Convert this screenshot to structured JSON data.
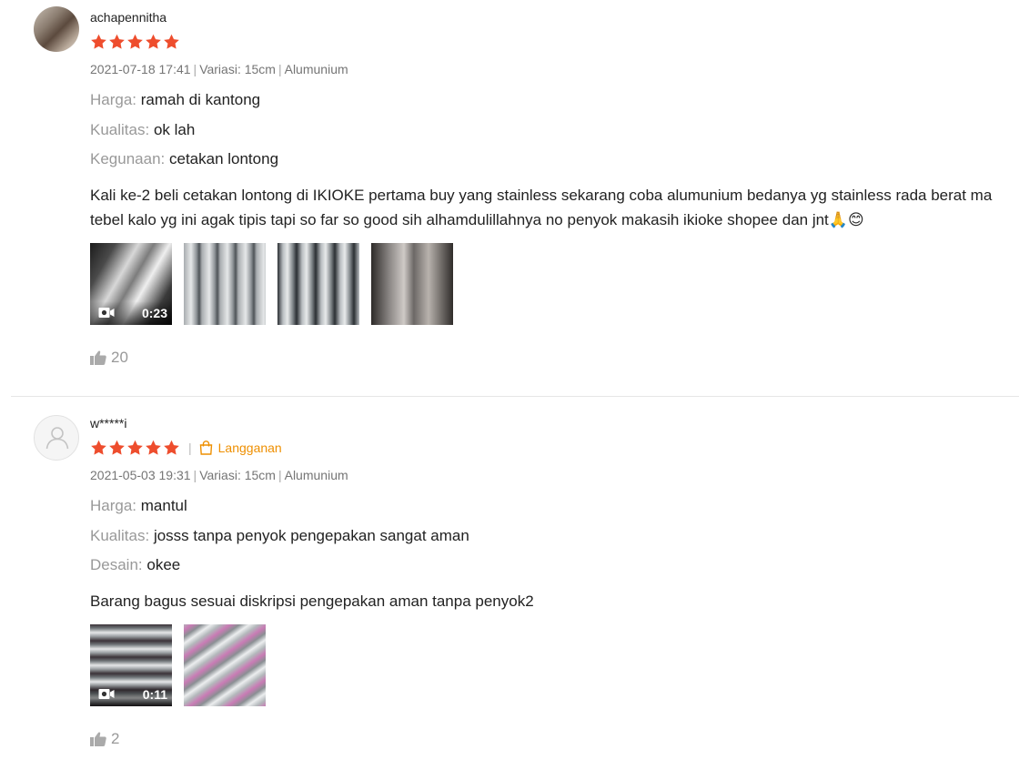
{
  "reviews": [
    {
      "username": "achapennitha",
      "rating": 5,
      "subscription": null,
      "date": "2021-07-18 17:41",
      "variation": "Variasi: 15cm",
      "material": "Alumunium",
      "attributes": [
        {
          "key": "Harga:",
          "value": "ramah di kantong"
        },
        {
          "key": "Kualitas:",
          "value": "ok lah"
        },
        {
          "key": "Kegunaan:",
          "value": "cetakan lontong"
        }
      ],
      "comment": "Kali ke-2 beli cetakan lontong di IKIOKE pertama buy yang stainless sekarang coba alumunium bedanya yg stainless rada berat ma tebel kalo yg ini agak tipis tapi so far so good sih alhamdulillahnya no penyok makasih ikioke shopee dan jnt🙏😊",
      "video_duration": "0:23",
      "likes": "20"
    },
    {
      "username": "w*****i",
      "rating": 5,
      "subscription": "Langganan",
      "date": "2021-05-03 19:31",
      "variation": "Variasi: 15cm",
      "material": "Alumunium",
      "attributes": [
        {
          "key": "Harga:",
          "value": "mantul"
        },
        {
          "key": "Kualitas:",
          "value": "josss tanpa penyok pengepakan sangat aman"
        },
        {
          "key": "Desain:",
          "value": " okee"
        }
      ],
      "comment": "Barang bagus sesuai diskripsi pengepakan aman tanpa penyok2",
      "video_duration": "0:11",
      "likes": "2"
    }
  ],
  "colors": {
    "star": "#ee4d2d",
    "subscription": "#ee8f00",
    "meta": "#757575",
    "attr_key": "#999999"
  },
  "icons": {
    "star": "star-icon",
    "video": "video-camera-icon",
    "like": "thumbs-up-icon",
    "subscription": "shopping-bag-icon",
    "avatar_default": "user-silhouette-icon"
  }
}
